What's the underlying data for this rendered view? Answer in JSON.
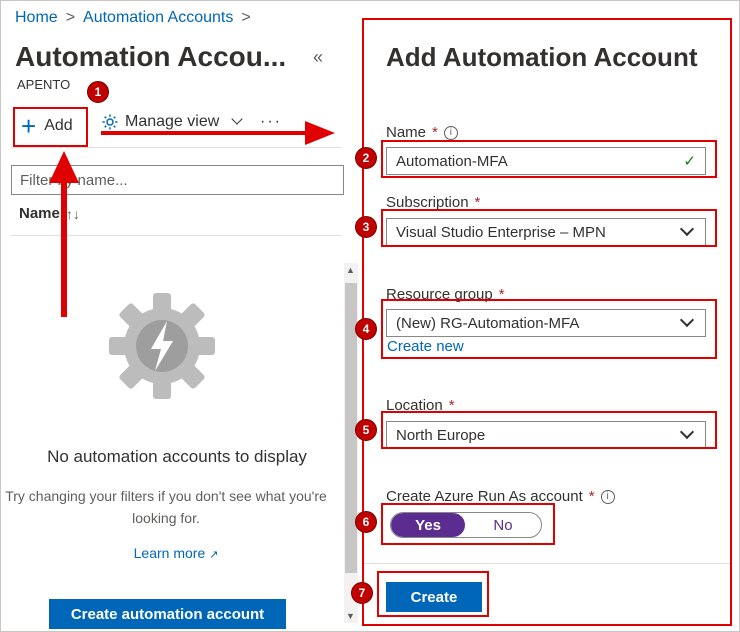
{
  "breadcrumb": {
    "home": "Home",
    "sep1": ">",
    "current": "Automation Accounts",
    "sep2": ">"
  },
  "left_blade": {
    "title": "Automation Accou...",
    "collapse_icon": "«",
    "subtitle": "APENTO",
    "toolbar": {
      "add_label": "Add",
      "manage_view_label": "Manage view",
      "more_label": "···"
    },
    "filter_placeholder": "Filter by name...",
    "column_header": "Name",
    "sort_glyph": "↑↓",
    "empty_title": "No automation accounts to display",
    "empty_desc": "Try changing your filters if you don't see what you're looking for.",
    "learn_more": "Learn more",
    "create_button": "Create automation account"
  },
  "right_blade": {
    "title": "Add Automation Account",
    "name_label": "Name",
    "name_value": "Automation-MFA",
    "subscription_label": "Subscription",
    "subscription_value": "Visual Studio Enterprise – MPN",
    "resource_group_label": "Resource group",
    "resource_group_value": "(New) RG-Automation-MFA",
    "create_new_link": "Create new",
    "location_label": "Location",
    "location_value": "North Europe",
    "run_as_label": "Create Azure Run As account",
    "toggle_yes": "Yes",
    "toggle_no": "No",
    "toggle_selected": "Yes",
    "create_button": "Create",
    "required_marker": "*",
    "info_glyph": "i",
    "check_glyph": "✓"
  },
  "markers": [
    "1",
    "2",
    "3",
    "4",
    "5",
    "6",
    "7"
  ],
  "colors": {
    "accent": "#0067b8",
    "annotation": "#e00000",
    "toggle_on": "#5c2d91",
    "valid": "#107c10"
  }
}
